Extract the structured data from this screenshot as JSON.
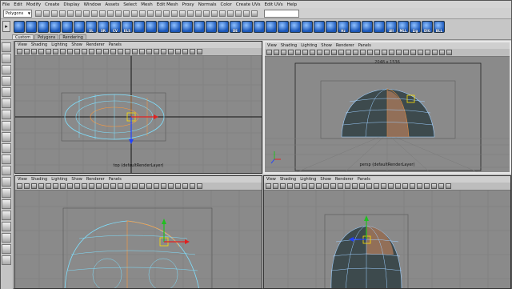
{
  "menubar": [
    "File",
    "Edit",
    "Modify",
    "Create",
    "Display",
    "Window",
    "Assets",
    "Select",
    "Mesh",
    "Edit Mesh",
    "Proxy",
    "Normals",
    "Color",
    "Create UVs",
    "Edit UVs",
    "Help"
  ],
  "status": {
    "mode": "Polygons"
  },
  "shelf": {
    "tabs": [
      "Custom",
      "Polygons",
      "Rendering"
    ],
    "icons": [
      "",
      "",
      "",
      "",
      "",
      "",
      "SL",
      "SR",
      "CV",
      "ELS",
      "",
      "",
      "",
      "",
      "",
      "",
      "",
      "",
      "DE",
      "",
      "",
      "",
      "",
      "",
      "",
      "",
      "",
      "Hz",
      "",
      "",
      "",
      "All",
      "MLL",
      "Lig",
      "DIG",
      "BLL"
    ]
  },
  "pane_menu": [
    "View",
    "Shading",
    "Lighting",
    "Show",
    "Renderer",
    "Panels"
  ],
  "panes": {
    "top": {
      "label": "top (defaultRenderLayer)"
    },
    "persp": {
      "label": "persp (defaultRenderLayer)",
      "resolution": "2048 x 1536"
    },
    "front": {
      "label": ""
    },
    "side": {
      "label": ""
    }
  },
  "colors": {
    "viewport_bg": "#8a8a8a",
    "wire_selected": "#7fe0ff",
    "wire_orange": "#ff9a3c",
    "mesh_dark": "#3d4a4d",
    "grid": "#777777"
  }
}
